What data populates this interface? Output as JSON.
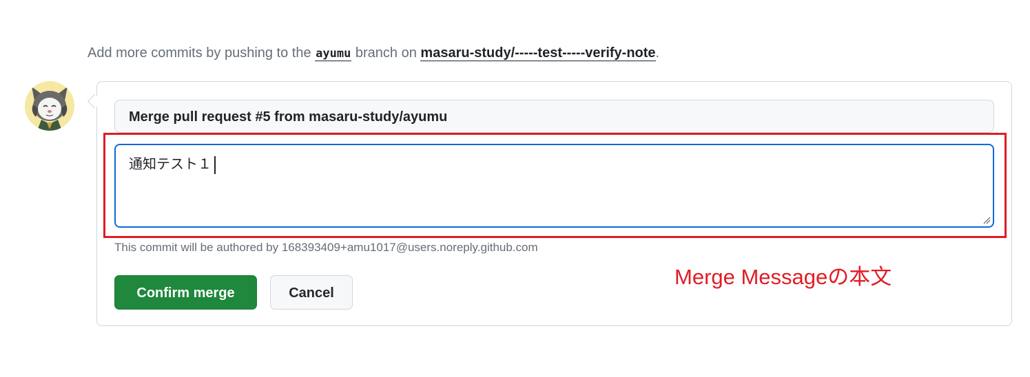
{
  "hint": {
    "prefix": "Add more commits by pushing to the ",
    "branch": "ayumu",
    "middle": " branch on ",
    "repo": "masaru-study/-----test-----verify-note",
    "suffix": "."
  },
  "merge_form": {
    "commit_title": "Merge pull request #5 from masaru-study/ayumu",
    "commit_body": "通知テスト１",
    "author_note": "This commit will be authored by 168393409+amu1017@users.noreply.github.com",
    "confirm_label": "Confirm merge",
    "cancel_label": "Cancel"
  },
  "annotation": {
    "text": "Merge Messageの本文",
    "color": "#e01c24"
  },
  "colors": {
    "confirm_button": "#1f883d",
    "focus_border": "#0969da",
    "highlight": "#e01c24"
  },
  "icons": {
    "avatar": "user-avatar-cat-character",
    "resize": "resize-grip-icon"
  }
}
